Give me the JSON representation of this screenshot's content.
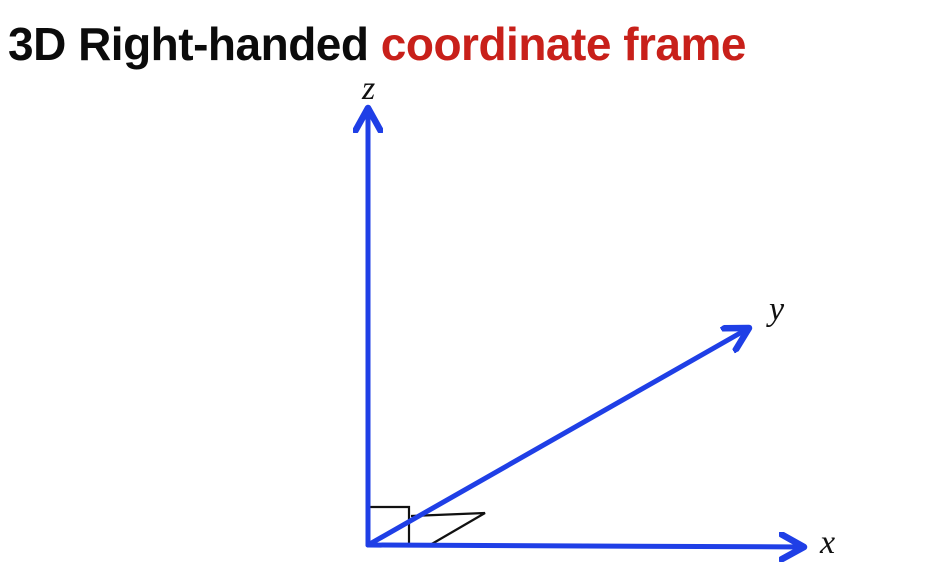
{
  "title": {
    "part1": "3D Right-handed",
    "part2": "coordinate frame"
  },
  "axes": {
    "x_label": "x",
    "y_label": "y",
    "z_label": "z"
  },
  "colors": {
    "title_dark": "#0b0b0b",
    "title_accent": "#c8201a",
    "axis": "#1f3fe6",
    "right_angle_marker": "#111111",
    "background": "#ffffff"
  }
}
